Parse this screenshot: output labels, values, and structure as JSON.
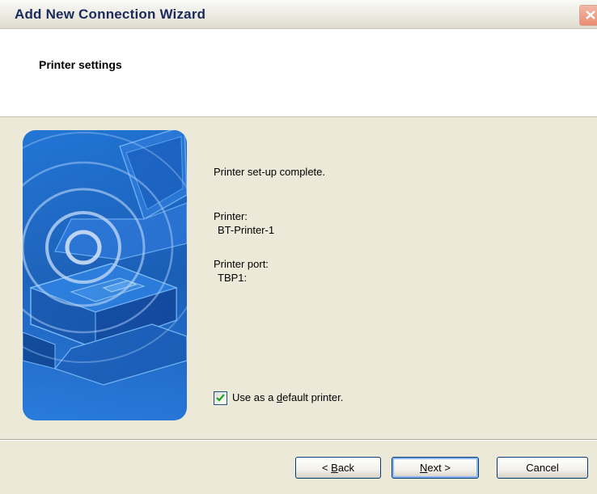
{
  "window": {
    "title": "Add New Connection Wizard",
    "close_icon": "close-icon"
  },
  "header": {
    "title": "Printer settings"
  },
  "main": {
    "setup_message": "Printer set-up complete.",
    "printer_label": "Printer:",
    "printer_value": "BT-Printer-1",
    "port_label": "Printer port:",
    "port_value": "TBP1:",
    "default_printer": {
      "label_before": "Use as a ",
      "label_mnemonic": "d",
      "label_after": "efault printer.",
      "checked": true
    }
  },
  "footer": {
    "back": {
      "prefix": "< ",
      "mnemonic": "B",
      "rest": "ack"
    },
    "next": {
      "mnemonic": "N",
      "rest": "ext >"
    },
    "cancel": "Cancel"
  },
  "colors": {
    "illustration_blue": "#1a5fb4",
    "title_text": "#1a2a5a",
    "button_border": "#003c74"
  }
}
